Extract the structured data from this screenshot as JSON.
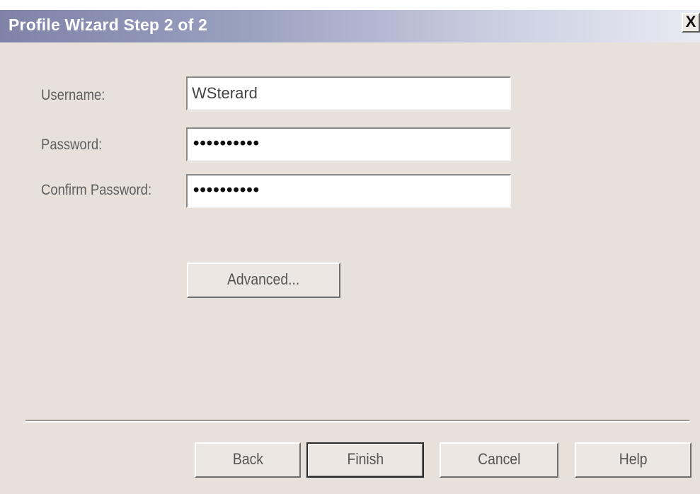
{
  "window": {
    "title": "Profile Wizard Step 2 of 2",
    "close_label": "X"
  },
  "form": {
    "username": {
      "label": "Username:",
      "value": "WSterard"
    },
    "password": {
      "label": "Password:",
      "masked_value": "••••••••••"
    },
    "confirm_password": {
      "label": "Confirm Password:",
      "masked_value": "••••••••••"
    },
    "advanced_label": "Advanced..."
  },
  "footer": {
    "back_label": "Back",
    "finish_label": "Finish",
    "cancel_label": "Cancel",
    "help_label": "Help"
  }
}
